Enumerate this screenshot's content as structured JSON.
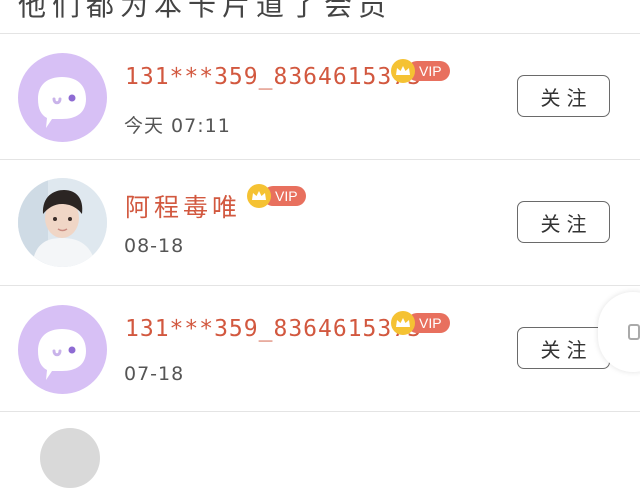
{
  "header": {
    "banner_text": "他们都为本卡片道了会员"
  },
  "list": {
    "items": [
      {
        "name": "131***359_8364615373",
        "vip_label": "VIP",
        "time": "今天 07:11",
        "follow_label": "关注",
        "avatar": "default-avatar-icon"
      },
      {
        "name": "阿程毒唯",
        "vip_label": "VIP",
        "time": "08-18",
        "follow_label": "关注",
        "avatar": "user-photo"
      },
      {
        "name": "131***359_8364615373",
        "vip_label": "VIP",
        "time": "07-18",
        "follow_label": "关注",
        "avatar": "default-avatar-icon"
      }
    ]
  },
  "colors": {
    "name": "#d2583f",
    "vip_badge": "#e8705e",
    "crown": "#f5c233",
    "default_avatar": "#d7c0f5"
  }
}
